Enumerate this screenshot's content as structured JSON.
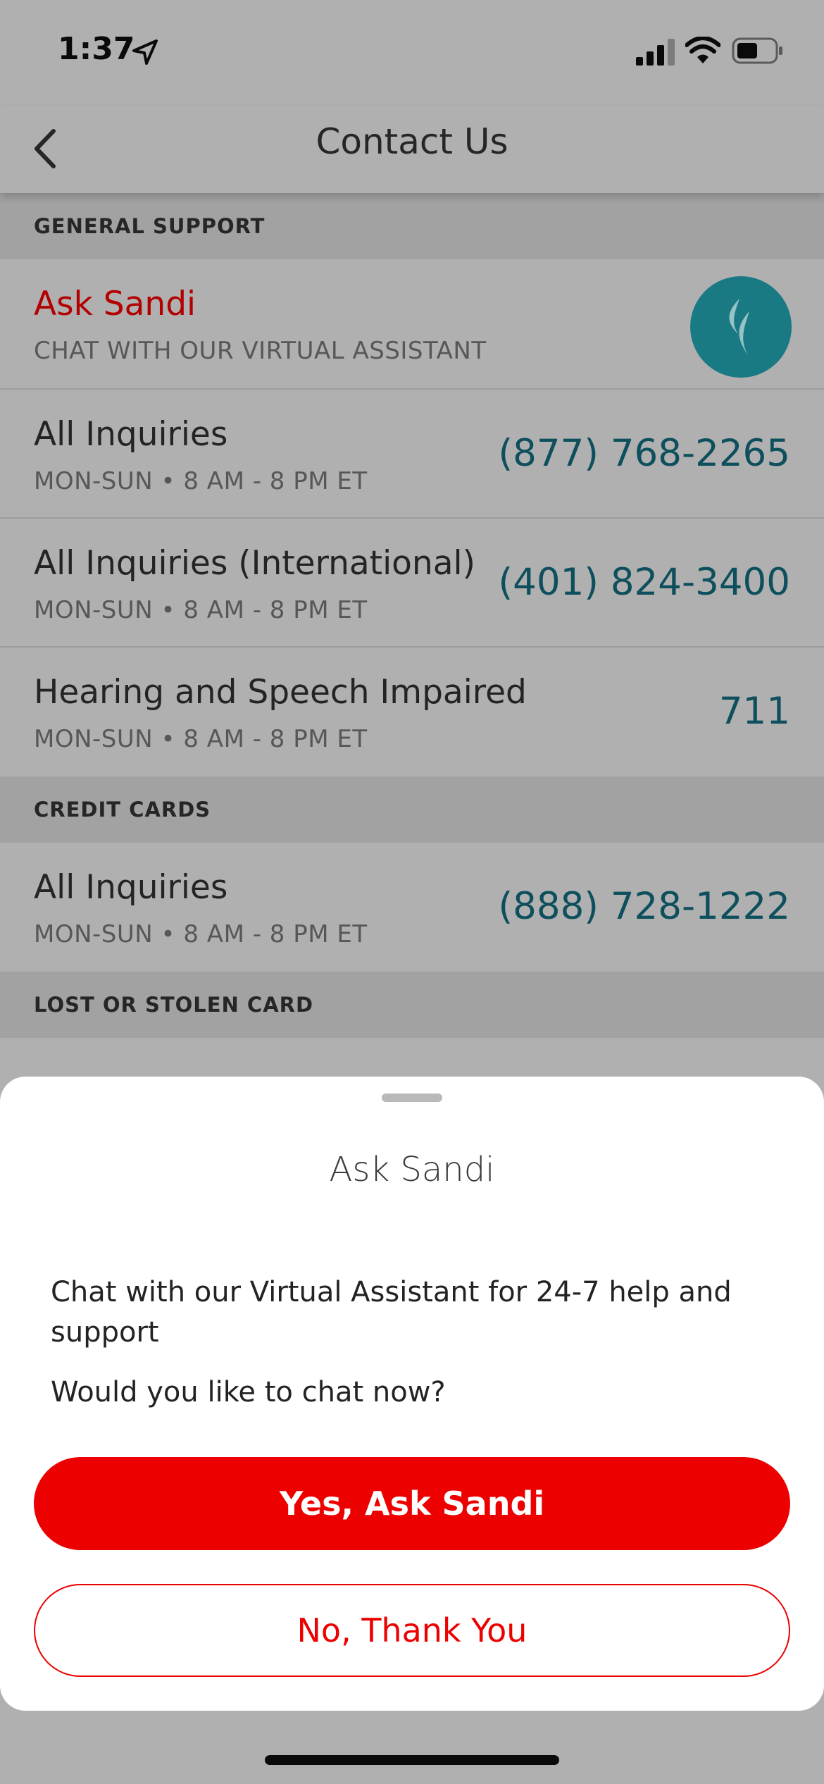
{
  "status_bar": {
    "time": "1:37",
    "icons": [
      "location-arrow-icon",
      "cellular-signal-icon",
      "wifi-icon",
      "battery-icon"
    ]
  },
  "nav": {
    "title": "Contact Us",
    "back_icon": "chevron-left-icon"
  },
  "sections": {
    "general_support": {
      "header": "GENERAL SUPPORT",
      "ask_sandi": {
        "title": "Ask Sandi",
        "subtitle": "CHAT WITH OUR VIRTUAL ASSISTANT",
        "icon": "sandi-flame-icon",
        "title_color": "#b30000",
        "avatar_color": "#1a7a84"
      },
      "rows": [
        {
          "title": "All Inquiries",
          "hours": "MON-SUN • 8 AM - 8 PM ET",
          "phone": "(877) 768-2265"
        },
        {
          "title": "All Inquiries (International)",
          "hours": "MON-SUN • 8 AM - 8 PM ET",
          "phone": "(401) 824-3400"
        },
        {
          "title": "Hearing and Speech Impaired",
          "hours": "MON-SUN • 8 AM - 8 PM ET",
          "phone": "711"
        }
      ]
    },
    "credit_cards": {
      "header": "CREDIT CARDS",
      "rows": [
        {
          "title": "All Inquiries",
          "hours": "MON-SUN • 8 AM - 8 PM ET",
          "phone": "(888) 728-1222"
        }
      ]
    },
    "lost_stolen": {
      "header": "LOST OR STOLEN CARD"
    }
  },
  "sheet": {
    "title": "Ask Sandi",
    "body": "Chat with our Virtual Assistant for 24-7 help and support",
    "question": "Would you like to chat now?",
    "primary_button": "Yes, Ask Sandi",
    "secondary_button": "No, Thank You",
    "accent_color": "#ec0000"
  },
  "colors": {
    "phone_text": "#0d4f5c",
    "overlay_background": "#b0b0b0",
    "section_header_background": "#a2a2a2"
  }
}
